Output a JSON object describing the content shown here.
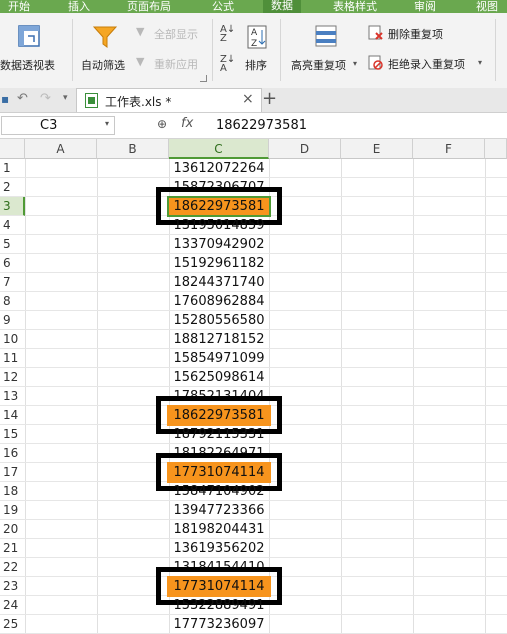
{
  "ribbon_tabs": [
    "开始",
    "插入",
    "页面布局",
    "公式",
    "数据",
    "表格样式",
    "审阅",
    "视图"
  ],
  "active_tab": "数据",
  "ribbon": {
    "pivot_label": "数据透视表",
    "autofilter_label": "自动筛选",
    "show_all_label": "全部显示",
    "reapply_label": "重新应用",
    "sort_label": "排序",
    "highlight_dup_label": "高亮重复项",
    "delete_dup_label": "删除重复项",
    "reject_dup_label": "拒绝录入重复项"
  },
  "document_tab": {
    "title": "工作表.xls *",
    "close": "×",
    "new_tab": "+"
  },
  "formula_bar": {
    "name_box": "C3",
    "fx": "fx",
    "value": "18622973581"
  },
  "columns": [
    "A",
    "B",
    "C",
    "D",
    "E",
    "F"
  ],
  "selected_column": "C",
  "rows": [
    {
      "n": "1",
      "c": "13612072264",
      "highlight": false
    },
    {
      "n": "2",
      "c": "15872306707",
      "highlight": false
    },
    {
      "n": "3",
      "c": "18622973581",
      "highlight": true
    },
    {
      "n": "4",
      "c": "13195014859",
      "highlight": false
    },
    {
      "n": "5",
      "c": "13370942902",
      "highlight": false
    },
    {
      "n": "6",
      "c": "15192961182",
      "highlight": false
    },
    {
      "n": "7",
      "c": "18244371740",
      "highlight": false
    },
    {
      "n": "8",
      "c": "17608962884",
      "highlight": false
    },
    {
      "n": "9",
      "c": "15280556580",
      "highlight": false
    },
    {
      "n": "10",
      "c": "18812718152",
      "highlight": false
    },
    {
      "n": "11",
      "c": "15854971099",
      "highlight": false
    },
    {
      "n": "12",
      "c": "15625098614",
      "highlight": false
    },
    {
      "n": "13",
      "c": "17852131404",
      "highlight": false
    },
    {
      "n": "14",
      "c": "18622973581",
      "highlight": true
    },
    {
      "n": "15",
      "c": "18792115331",
      "highlight": false
    },
    {
      "n": "16",
      "c": "18182264971",
      "highlight": false
    },
    {
      "n": "17",
      "c": "17731074114",
      "highlight": true
    },
    {
      "n": "18",
      "c": "15847104902",
      "highlight": false
    },
    {
      "n": "19",
      "c": "13947723366",
      "highlight": false
    },
    {
      "n": "20",
      "c": "18198204431",
      "highlight": false
    },
    {
      "n": "21",
      "c": "13619356202",
      "highlight": false
    },
    {
      "n": "22",
      "c": "13184154410",
      "highlight": false
    },
    {
      "n": "23",
      "c": "17731074114",
      "highlight": true
    },
    {
      "n": "24",
      "c": "15322889491",
      "highlight": false
    },
    {
      "n": "25",
      "c": "17773236097",
      "highlight": false
    }
  ],
  "colors": {
    "highlight": "#f7941d",
    "ribbon_green": "#6aa84f",
    "selection": "#4f9a35"
  }
}
